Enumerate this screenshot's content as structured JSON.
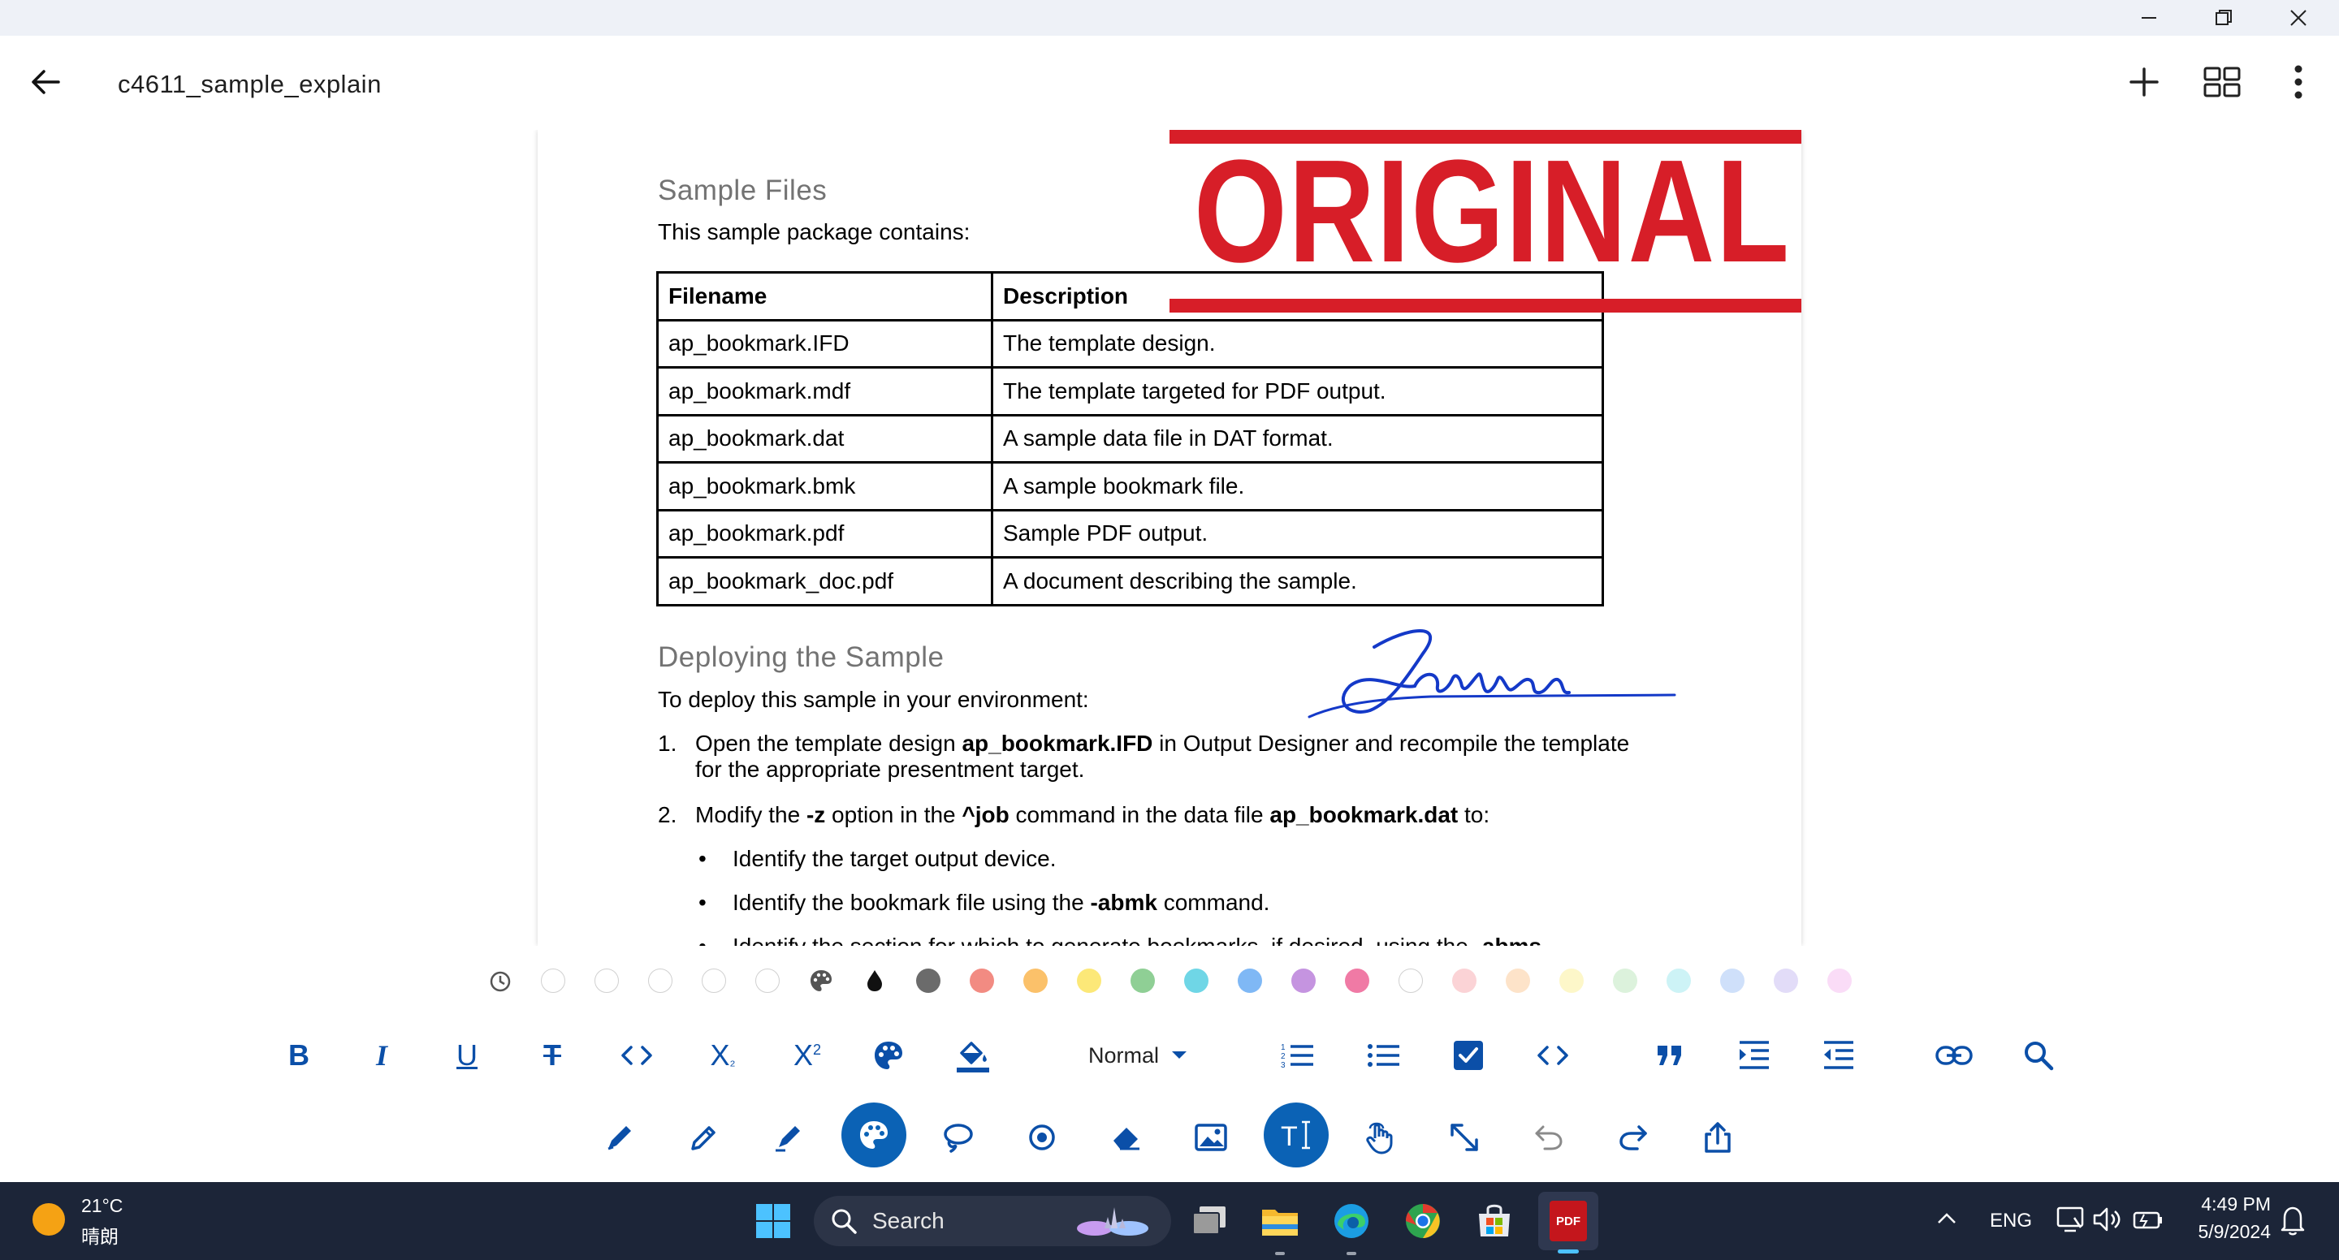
{
  "window": {
    "controls": [
      "minimize-icon",
      "restore-icon",
      "close-icon"
    ]
  },
  "header": {
    "title": "c4611_sample_explain",
    "back_icon": "arrow-left-icon",
    "actions": [
      "plus-icon",
      "grid-view-icon",
      "more-vertical-icon"
    ]
  },
  "document": {
    "section1_title": "Sample Files",
    "section1_intro": "This sample package contains:",
    "table": {
      "headers": [
        "Filename",
        "Description"
      ],
      "rows": [
        [
          "ap_bookmark.IFD",
          "The template design."
        ],
        [
          "ap_bookmark.mdf",
          "The template targeted for PDF output."
        ],
        [
          "ap_bookmark.dat",
          "A sample data file in DAT format."
        ],
        [
          "ap_bookmark.bmk",
          "A sample bookmark file."
        ],
        [
          "ap_bookmark.pdf",
          "Sample PDF output."
        ],
        [
          "ap_bookmark_doc.pdf",
          "A document describing the sample."
        ]
      ]
    },
    "stamp_text": "ORIGINAL",
    "signature_text": "Jarison",
    "section2_title": "Deploying the Sample",
    "section2_intro": "To deploy this sample in your environment:",
    "steps": [
      {
        "num": "1.",
        "parts": [
          "Open the template design ",
          "ap_bookmark.IFD",
          " in Output Designer and recompile the template for the appropriate presentment target."
        ]
      },
      {
        "num": "2.",
        "parts": [
          "Modify the ",
          "-z",
          " option in the ",
          "^job",
          " command in the data file ",
          "ap_bookmark.dat",
          " to:"
        ]
      }
    ],
    "bullets": [
      {
        "parts": [
          "Identify the target output device.",
          "",
          ""
        ]
      },
      {
        "parts": [
          "Identify the bookmark file using the ",
          "-abmk",
          " command."
        ]
      },
      {
        "parts": [
          "Identify the section for which to generate bookmarks, if desired, using the ",
          "-abms",
          ""
        ]
      }
    ],
    "bullet_char": "•"
  },
  "palette": {
    "history_icon": "history-icon",
    "colors": [
      "#ffffff",
      "#ffffff",
      "#ffffff",
      "#ffffff",
      "#ffffff",
      "palette-icon",
      "ink-drop-icon",
      "#6b6b6b",
      "#f28b82",
      "#fbc16a",
      "#fce878",
      "#8fcf95",
      "#6fd6e6",
      "#7fb8f5",
      "#c594e0",
      "#f07aa5",
      "#ffffff",
      "#fbd3d6",
      "#fde3c9",
      "#fdf7c9",
      "#dcf2dc",
      "#cdf3f6",
      "#cfe0fa",
      "#e2dcf8",
      "#fadcf7"
    ]
  },
  "format_toolbar": {
    "buttons": [
      "bold-icon",
      "italic-icon",
      "underline-icon",
      "strikethrough-icon",
      "code-icon",
      "subscript-icon",
      "superscript-icon",
      "text-color-icon",
      "fill-color-icon"
    ],
    "style_dropdown": "Normal",
    "buttons_right": [
      "numbered-list-icon",
      "bullet-list-icon",
      "checkbox-icon",
      "code-block-icon",
      "quote-icon",
      "indent-icon",
      "outdent-icon",
      "link-icon",
      "search-icon"
    ]
  },
  "tool_row": {
    "tools": [
      "pen-icon",
      "pencil-icon",
      "highlighter-icon",
      "palette-icon",
      "lasso-icon",
      "target-icon",
      "eraser-icon",
      "image-icon",
      "text-icon",
      "touch-icon",
      "expand-icon",
      "undo-icon",
      "redo-icon",
      "share-icon"
    ],
    "active": [
      "palette-icon",
      "text-icon"
    ]
  },
  "taskbar": {
    "weather_temp": "21°C",
    "weather_desc": "晴朗",
    "search_placeholder": "Search",
    "apps": [
      "windows-start-icon",
      "task-view-icon",
      "file-explorer-icon",
      "edge-icon",
      "chrome-icon",
      "store-icon",
      "pdf-app-icon"
    ],
    "pdf_label": "PDF",
    "language": "ENG",
    "time": "4:49 PM",
    "date": "5/9/2024"
  }
}
